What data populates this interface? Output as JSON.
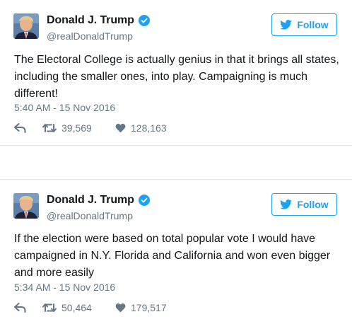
{
  "colors": {
    "brand_blue": "#1da1f2",
    "text_primary": "#14171a",
    "text_secondary": "#657786",
    "divider": "#e1e8ed"
  },
  "tweets": [
    {
      "author": "Donald J. Trump",
      "handle": "@realDonaldTrump",
      "verified": true,
      "follow_label": "Follow",
      "text": "The Electoral College is actually genius in that it brings all states, including the smaller ones, into play. Campaigning is much different!",
      "timestamp": "5:40 AM - 15 Nov 2016",
      "retweets": "39,569",
      "likes": "128,163",
      "icons": {
        "reply": "reply-icon",
        "retweet": "retweet-icon",
        "like": "heart-icon"
      }
    },
    {
      "author": "Donald J. Trump",
      "handle": "@realDonaldTrump",
      "verified": true,
      "follow_label": "Follow",
      "text": "If the election were based on total popular vote I would have campaigned in N.Y. Florida and California and won even bigger and more easily",
      "timestamp": "5:34 AM - 15 Nov 2016",
      "retweets": "50,464",
      "likes": "179,517",
      "icons": {
        "reply": "reply-icon",
        "retweet": "retweet-icon",
        "like": "heart-icon"
      }
    }
  ]
}
